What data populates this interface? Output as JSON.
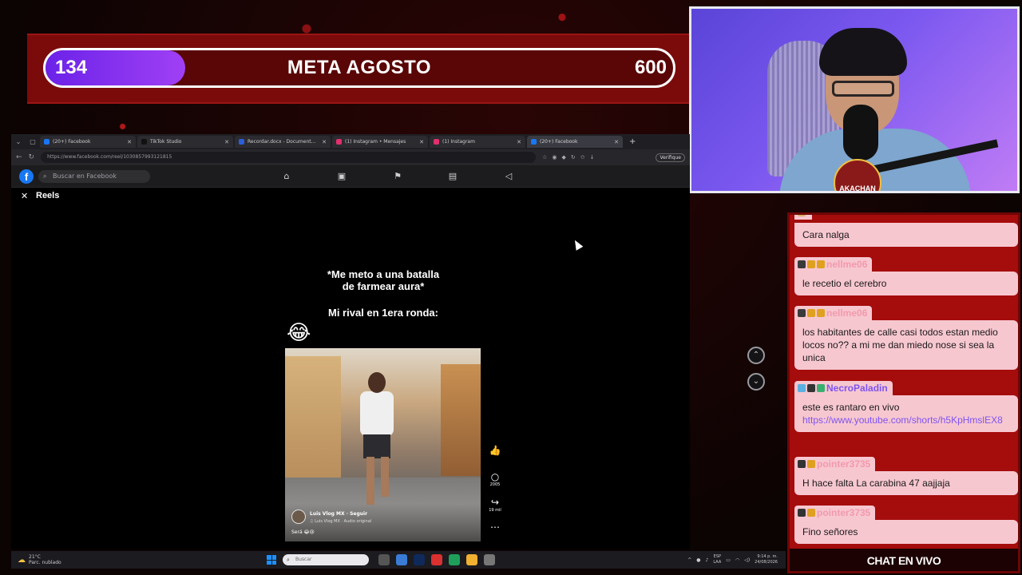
{
  "goal": {
    "current": "134",
    "title": "META AGOSTO",
    "target": "600",
    "progress_fraction": 0.223,
    "fill_color": "#8a33f0"
  },
  "webcam": {
    "logo_text": "AKACHAN"
  },
  "browser": {
    "tabs": [
      {
        "label": "(20+) Facebook",
        "icon_color": "#1877f2",
        "active": false
      },
      {
        "label": "TikTok Studio",
        "icon_color": "#111111",
        "active": false
      },
      {
        "label": "Recordar.docx - Documentos de",
        "icon_color": "#2b5fd9",
        "active": false
      },
      {
        "label": "(1) Instagram • Mensajes",
        "icon_color": "#e1306c",
        "active": false
      },
      {
        "label": "(1) Instagram",
        "icon_color": "#e1306c",
        "active": false
      },
      {
        "label": "(20+) Facebook",
        "icon_color": "#1877f2",
        "active": true
      }
    ],
    "url": "https://www.facebook.com/reel/1030857993121815",
    "verify_label": "Verifique"
  },
  "facebook": {
    "search_placeholder": "Buscar en Facebook",
    "reels_title": "Reels",
    "caption_line1": "*Me meto a una batalla",
    "caption_line2": "de farmear aura*",
    "caption_rival": "Mi rival en 1era ronda:",
    "emoji": "😂",
    "video": {
      "author": "Luis Vlog MX  ·  Seguir",
      "audio": "♫ Luis Vlog MX · Audio original",
      "description": "Será 😂😢"
    },
    "actions": {
      "comments_count": "2005",
      "shares_count": "19 mil"
    }
  },
  "taskbar": {
    "temperature": "21°C",
    "weather_desc": "Parc. nublado",
    "search_placeholder": "Buscar",
    "lang_top": "ESP",
    "lang_bottom": "LAA",
    "time": "9:14 p. m.",
    "date": "24/08/2026"
  },
  "chat": {
    "footer": "CHAT EN VIVO",
    "messages": [
      {
        "name": "",
        "text": "Cara nalga"
      },
      {
        "name": "nellme06",
        "text": "le recetio el cerebro"
      },
      {
        "name": "nellme06",
        "text": "los habitantes de calle casi todos estan medio locos no?? a mi me dan miedo nose si sea la unica"
      },
      {
        "name": "NecroPaladin",
        "text": "este es rantaro en vivo",
        "link": "https://www.youtube.com/shorts/h5KpHmslEX8"
      },
      {
        "name": "pointer3735",
        "text": "H hace falta La carabina 47 aajjaja"
      },
      {
        "name": "pointer3735",
        "text": "Fino señores"
      }
    ]
  }
}
